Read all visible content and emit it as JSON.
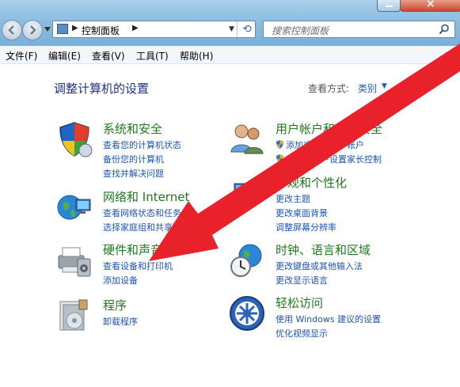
{
  "window": {
    "breadcrumb_root": "控制面板",
    "search_placeholder": "搜索控制面板"
  },
  "menu": [
    "文件(F)",
    "编辑(E)",
    "查看(V)",
    "工具(T)",
    "帮助(H)"
  ],
  "page": {
    "title": "调整计算机的设置",
    "view_by_label": "查看方式:",
    "view_by_value": "类别"
  },
  "categories": [
    {
      "title": "系统和安全",
      "links": [
        "查看您的计算机状态",
        "备份您的计算机",
        "查找并解决问题"
      ]
    },
    {
      "title": "网络和 Internet",
      "links": [
        "查看网络状态和任务",
        "选择家庭组和共享选项"
      ]
    },
    {
      "title": "硬件和声音",
      "links": [
        "查看设备和打印机",
        "添加设备"
      ]
    },
    {
      "title": "程序",
      "links": [
        "卸载程序"
      ]
    },
    {
      "title": "用户帐户和家庭安全",
      "links": [
        "添加或删除用户帐户",
        "为所有用户设置家长控制"
      ]
    },
    {
      "title": "外观和个性化",
      "links": [
        "更改主题",
        "更改桌面背景",
        "调整屏幕分辨率"
      ]
    },
    {
      "title": "时钟、语言和区域",
      "links": [
        "更改键盘或其他输入法",
        "更改显示语言"
      ]
    },
    {
      "title": "轻松访问",
      "links": [
        "使用 Windows 建议的设置",
        "优化视频显示"
      ]
    }
  ],
  "colors": {
    "annotation_arrow": "#e8212a",
    "category_title": "#1e7a1e",
    "link": "#1a55b8"
  }
}
